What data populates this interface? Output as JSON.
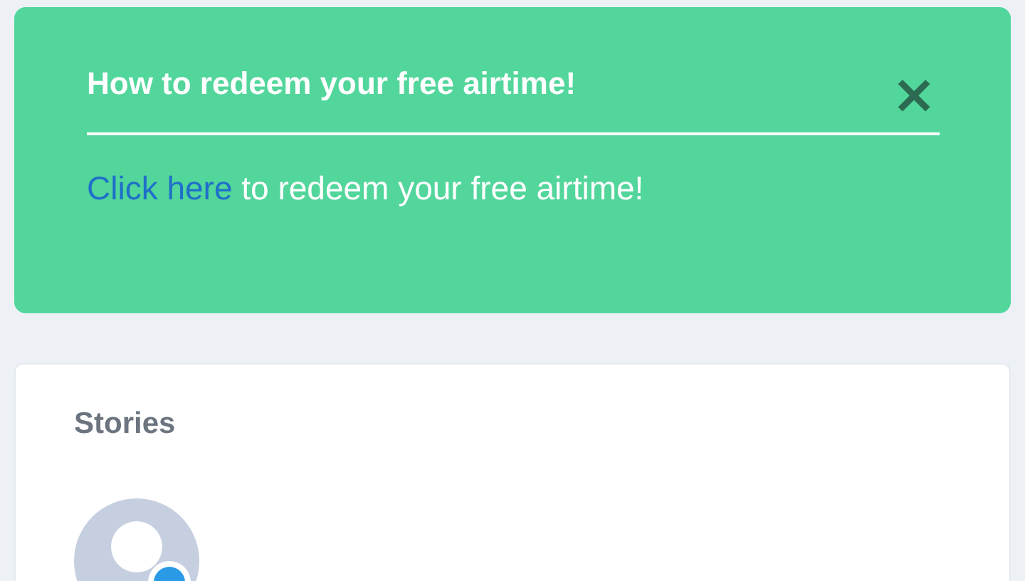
{
  "banner": {
    "title": "How to redeem your free airtime!",
    "close_label": "×",
    "link_text": "Click here",
    "text": "to redeem your free airtime!"
  },
  "stories": {
    "title": "Stories"
  }
}
